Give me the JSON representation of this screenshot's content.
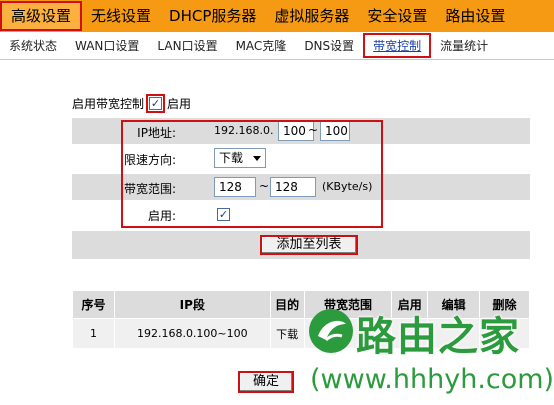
{
  "topnav": {
    "items": [
      "高级设置",
      "无线设置",
      "DHCP服务器",
      "虚拟服务器",
      "安全设置",
      "路由设置"
    ],
    "active": 0
  },
  "subnav": {
    "tabs": [
      "系统状态",
      "WAN口设置",
      "LAN口设置",
      "MAC克隆",
      "DNS设置",
      "带宽控制",
      "流量统计"
    ],
    "active": 5
  },
  "enable": {
    "label": "启用带宽控制",
    "suffix": "启用",
    "checked": "✓"
  },
  "form": {
    "ip_label": "IP地址:",
    "ip_prefix": "192.168.0.",
    "ip_start": "100",
    "ip_sep": "~",
    "ip_end": "100",
    "direction_label": "限速方向:",
    "direction_value": "下载",
    "range_label": "带宽范围:",
    "range_min": "128",
    "range_sep": "~",
    "range_max": "128",
    "range_unit": "(KByte/s)",
    "enable_label": "启用:",
    "enable_checked": "✓"
  },
  "add_button": "添加至列表",
  "table": {
    "headers": [
      "序号",
      "IP段",
      "目的",
      "带宽范围",
      "启用",
      "编辑",
      "删除"
    ],
    "rows": [
      [
        "1",
        "192.168.0.100~100",
        "下载",
        "",
        "",
        "",
        ""
      ]
    ]
  },
  "ok_button": "确定",
  "watermark": {
    "title": "路由之家",
    "url": "(www.hhhyh.com)"
  },
  "colors": {
    "nav": "#f59a12",
    "highlight": "#d01010",
    "row": "#dcdcdc",
    "brand": "#2c9b3d"
  }
}
